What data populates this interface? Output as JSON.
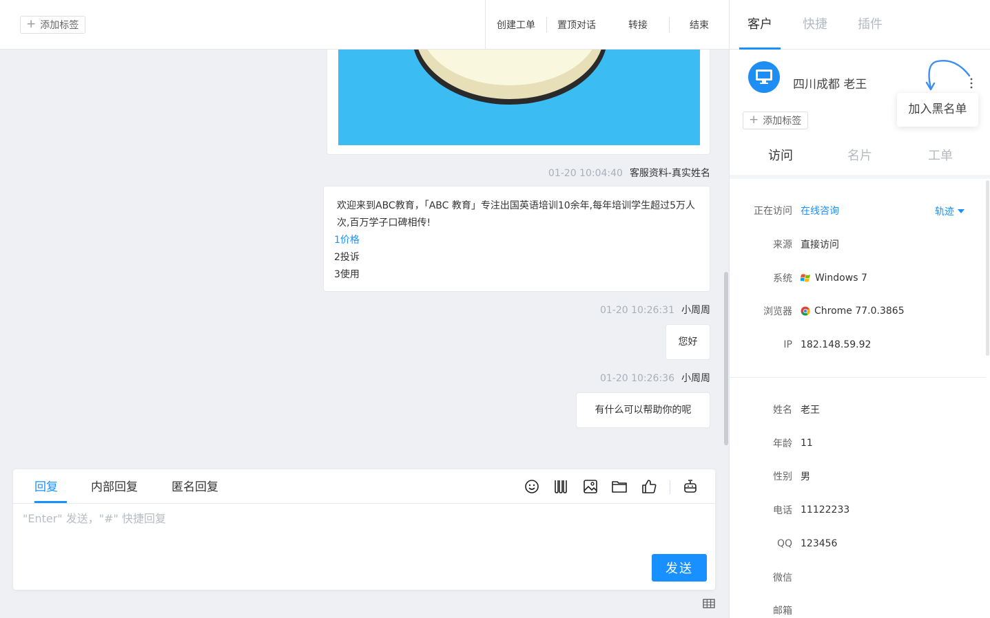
{
  "topbar": {
    "add_tag": "添加标签",
    "actions": [
      "创建工单",
      "置顶对话",
      "转接",
      "结束"
    ]
  },
  "messages": [
    {
      "time": "01-20 10:04:40",
      "sender": "客服资料-真实姓名",
      "lines": [
        "欢迎来到ABC教育，「ABC 教育」专注出国英语培训10余年,每年培训学生超过5万人次,百万学子口碑相传!"
      ],
      "options": [
        "1价格",
        "2投诉",
        "3使用"
      ]
    },
    {
      "time": "01-20 10:26:31",
      "sender": "小周周",
      "text": "您好"
    },
    {
      "time": "01-20 10:26:36",
      "sender": "小周周",
      "text": "有什么可以帮助你的呢"
    }
  ],
  "reply": {
    "tabs": [
      "回复",
      "内部回复",
      "匿名回复"
    ],
    "active_tab": "回复",
    "placeholder": "\"Enter\" 发送，\"#\" 快捷回复",
    "send_label": "发送",
    "toolbar_icons": [
      "smiley-icon",
      "quick-reply-icon",
      "image-icon",
      "folder-icon",
      "thumbs-up-icon",
      "robot-icon"
    ]
  },
  "panel": {
    "tabs": [
      "客户",
      "快捷",
      "插件"
    ],
    "active_tab": "客户",
    "customer": {
      "name": "四川成都 老王",
      "add_tag": "添加标签",
      "menu_item": "加入黑名单"
    },
    "sub_tabs": [
      "访问",
      "名片",
      "工单"
    ],
    "active_sub_tab": "访问",
    "visit": {
      "visiting_label": "正在访问",
      "visiting_value": "在线咨询",
      "track_label": "轨迹",
      "source_label": "来源",
      "source_value": "直接访问",
      "os_label": "系统",
      "os_value": "Windows 7",
      "browser_label": "浏览器",
      "browser_value": "Chrome 77.0.3865",
      "ip_label": "IP",
      "ip_value": "182.148.59.92"
    },
    "profile": {
      "name_label": "姓名",
      "name_value": "老王",
      "age_label": "年龄",
      "age_value": "11",
      "gender_label": "性别",
      "gender_value": "男",
      "phone_label": "电话",
      "phone_value": "11122233",
      "qq_label": "QQ",
      "qq_value": "123456",
      "wechat_label": "微信",
      "wechat_value": "",
      "email_label": "邮箱",
      "email_value": ""
    }
  },
  "colors": {
    "accent": "#1890ff",
    "image_bg": "#3bbdf3",
    "avatar": "#1e8ef5"
  }
}
